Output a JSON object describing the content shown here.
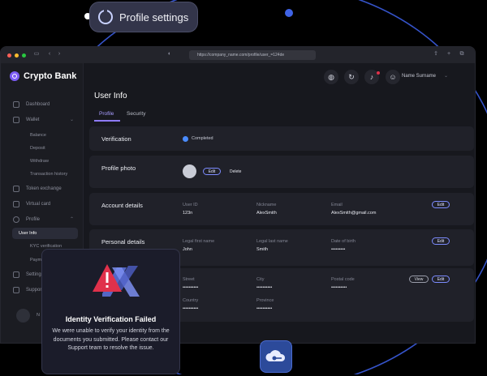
{
  "callout": {
    "label": "Profile settings"
  },
  "browser": {
    "url": "https://company_name.com/profile/user_=124de"
  },
  "sidebar": {
    "brand": "Crypto Bank",
    "items": [
      {
        "label": "Dashboard"
      },
      {
        "label": "Wallet"
      },
      {
        "label": "Balance"
      },
      {
        "label": "Deposit"
      },
      {
        "label": "Withdraw"
      },
      {
        "label": "Transaction history"
      },
      {
        "label": "Token exchange"
      },
      {
        "label": "Virtual card"
      },
      {
        "label": "Profile"
      },
      {
        "label": "User Info"
      },
      {
        "label": "KYC verification"
      },
      {
        "label": "Payment"
      },
      {
        "label": "Settings"
      },
      {
        "label": "Support"
      },
      {
        "label": "N"
      }
    ]
  },
  "header": {
    "user_name": "Name Surname"
  },
  "page": {
    "title": "User Info",
    "tabs": [
      {
        "label": "Profile"
      },
      {
        "label": "Security"
      }
    ]
  },
  "verification": {
    "label": "Verification",
    "status": "Completed"
  },
  "photo": {
    "label": "Profile photo",
    "edit": "Edit",
    "delete": "Delete"
  },
  "account": {
    "label": "Account details",
    "fields": [
      {
        "label": "User ID",
        "value": "123n"
      },
      {
        "label": "Nickname",
        "value": "AlexSmith"
      },
      {
        "label": "Email",
        "value": "AlexSmith@gmail.com"
      }
    ],
    "edit": "Edit"
  },
  "personal": {
    "label": "Personal details",
    "fields": [
      {
        "label": "Legal first name",
        "value": "John"
      },
      {
        "label": "Legal last name",
        "value": "Smith"
      },
      {
        "label": "Date of birth",
        "value": "•••••••••"
      }
    ],
    "edit": "Edit"
  },
  "address": {
    "fields": [
      {
        "label": "Street",
        "value": "••••••••••"
      },
      {
        "label": "City",
        "value": "••••••••••"
      },
      {
        "label": "Postal code",
        "value": "••••••••••"
      },
      {
        "label": "Country",
        "value": "••••••••••"
      },
      {
        "label": "Province",
        "value": "••••••••••"
      }
    ],
    "view": "View",
    "edit": "Edit"
  },
  "dialog": {
    "title": "Identity Verification Failed",
    "body": "We were unable to verify your identity from the documents you submitted. Please contact our Support team to resolve the issue."
  },
  "colors": {
    "accent": "#7c5cf6",
    "background": "#000000",
    "card": "#202129",
    "error": "#e0314b"
  }
}
